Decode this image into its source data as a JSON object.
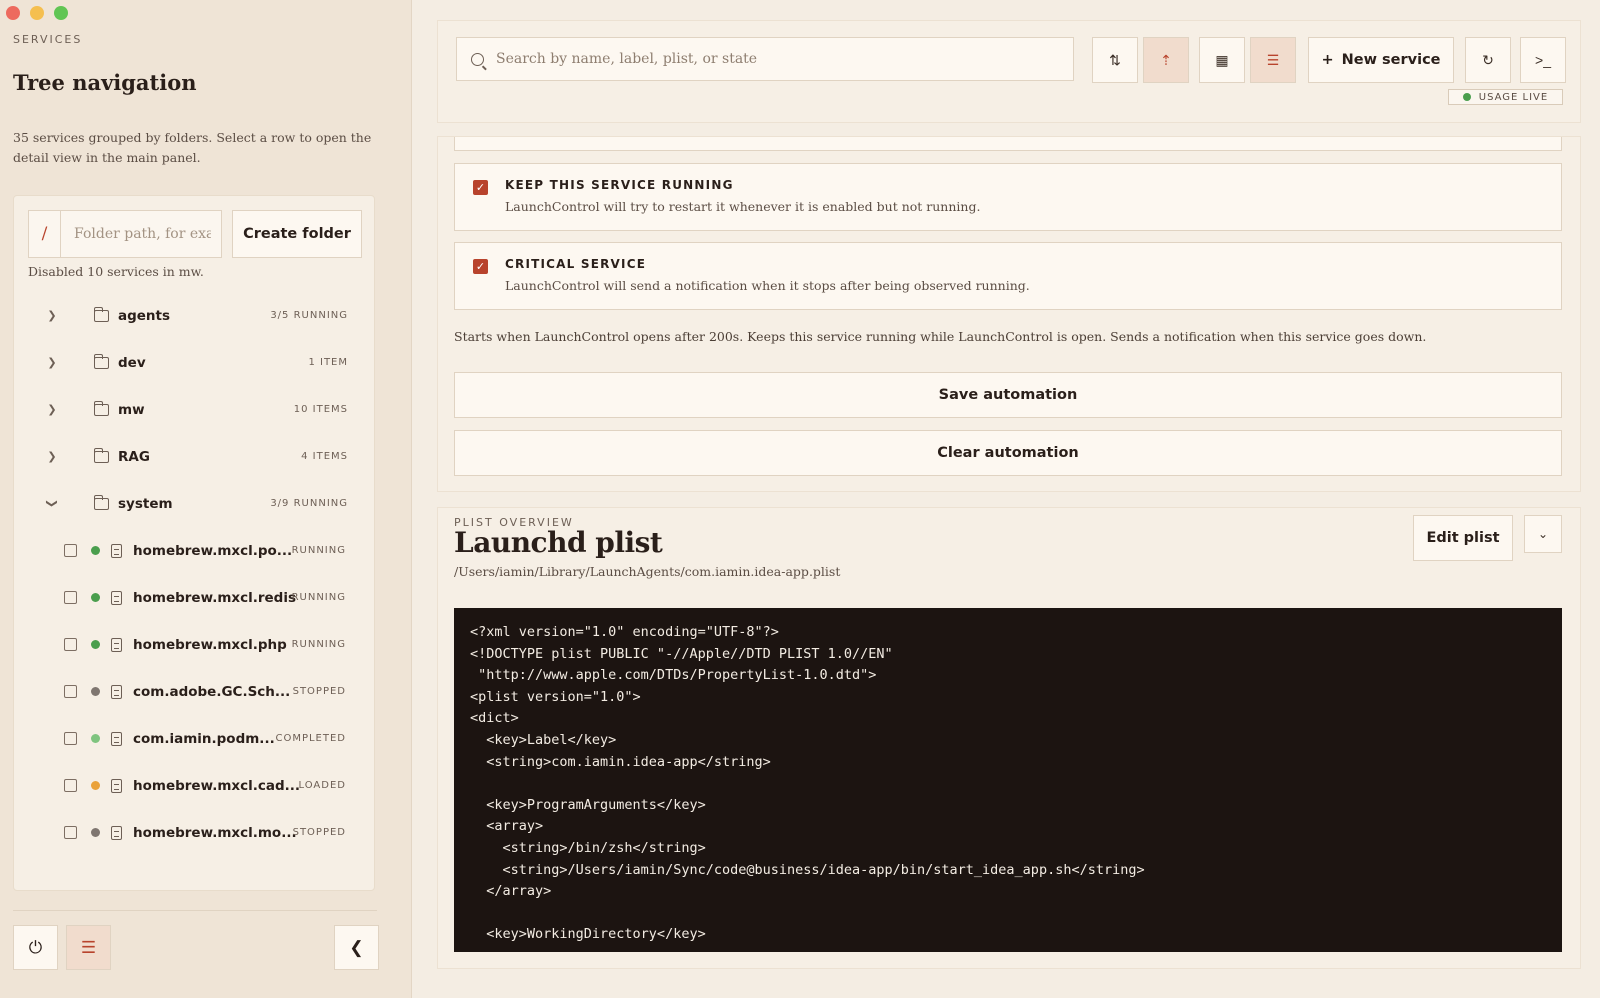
{
  "window": {
    "traffic_colors": [
      "#ed6a5e",
      "#f5bf4f",
      "#61c554"
    ]
  },
  "sidebar": {
    "eyebrow": "SERVICES",
    "title": "Tree navigation",
    "description": "35 services grouped by folders. Select a row to open the detail view in the main panel.",
    "folder_prefix": "/",
    "folder_placeholder": "Folder path, for example",
    "create_folder_label": "Create folder",
    "disabled_note": "Disabled 10 services in mw.",
    "folders": [
      {
        "name": "agents",
        "count": "3/5 RUNNING",
        "expanded": false
      },
      {
        "name": "dev",
        "count": "1 ITEM",
        "expanded": false
      },
      {
        "name": "mw",
        "count": "10 ITEMS",
        "expanded": false
      },
      {
        "name": "RAG",
        "count": "4 ITEMS",
        "expanded": false
      },
      {
        "name": "system",
        "count": "3/9 RUNNING",
        "expanded": true
      }
    ],
    "services": [
      {
        "name": "homebrew.mxcl.po...",
        "state": "RUNNING",
        "dot": "#4a9e4d"
      },
      {
        "name": "homebrew.mxcl.redis",
        "state": "RUNNING",
        "dot": "#4a9e4d"
      },
      {
        "name": "homebrew.mxcl.php",
        "state": "RUNNING",
        "dot": "#4a9e4d"
      },
      {
        "name": "com.adobe.GC.Sch...",
        "state": "STOPPED",
        "dot": "#7f7670"
      },
      {
        "name": "com.iamin.podm...",
        "state": "COMPLETED",
        "dot": "#7fc47f"
      },
      {
        "name": "homebrew.mxcl.cad...",
        "state": "LOADED",
        "dot": "#eaa23a"
      },
      {
        "name": "homebrew.mxcl.mo...",
        "state": "STOPPED",
        "dot": "#7f7670"
      }
    ],
    "footer": {
      "power_icon": "power-icon",
      "tree_icon": "tree-icon",
      "collapse_icon": "chevron-left-icon"
    }
  },
  "toolbar": {
    "search_placeholder": "Search by name, label, plist, or state",
    "new_service_label": "New service",
    "usage_label": "USAGE LIVE"
  },
  "automation": {
    "keep_running_title": "KEEP THIS SERVICE RUNNING",
    "keep_running_desc": "LaunchControl will try to restart it whenever it is enabled but not running.",
    "critical_title": "CRITICAL SERVICE",
    "critical_desc": "LaunchControl will send a notification when it stops after being observed running.",
    "summary": "Starts when LaunchControl opens after 200s. Keeps this service running while LaunchControl is open. Sends a notification when this service goes down.",
    "save_label": "Save automation",
    "clear_label": "Clear automation"
  },
  "plist": {
    "eyebrow": "PLIST OVERVIEW",
    "title": "Launchd plist",
    "path": "/Users/iamin/Library/LaunchAgents/com.iamin.idea-app.plist",
    "edit_label": "Edit plist",
    "code": "<?xml version=\"1.0\" encoding=\"UTF-8\"?>\n<!DOCTYPE plist PUBLIC \"-//Apple//DTD PLIST 1.0//EN\"\n \"http://www.apple.com/DTDs/PropertyList-1.0.dtd\">\n<plist version=\"1.0\">\n<dict>\n  <key>Label</key>\n  <string>com.iamin.idea-app</string>\n\n  <key>ProgramArguments</key>\n  <array>\n    <string>/bin/zsh</string>\n    <string>/Users/iamin/Sync/code@business/idea-app/bin/start_idea_app.sh</string>\n  </array>\n\n  <key>WorkingDirectory</key>"
  },
  "colors": {
    "accent": "#b8432c",
    "running": "#4a9e4d"
  }
}
